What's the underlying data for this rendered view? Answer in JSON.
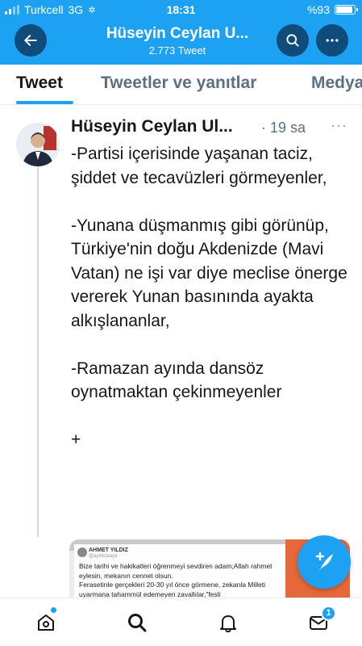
{
  "status_bar": {
    "carrier": "Turkcell",
    "network": "3G",
    "time": "18:31",
    "battery_text": "%93",
    "battery_level": 0.93
  },
  "header": {
    "title": "Hüseyin Ceylan U...",
    "subtitle": "2.773 Tweet",
    "back_icon": "arrow-left-icon",
    "search_icon": "search-icon",
    "more_icon": "more-horizontal-icon"
  },
  "tabs": [
    {
      "label": "Tweet",
      "active": true
    },
    {
      "label": "Tweetler ve yanıtlar",
      "active": false
    },
    {
      "label": "Medya",
      "active": false
    }
  ],
  "tweet": {
    "author": "Hüseyin Ceylan Ul...",
    "time": "· 19 sa",
    "more": "···",
    "text": "-Partisi içerisinde yaşanan taciz, şiddet ve tecavüzleri görmeyenler,\n\n-Yunana düşmanmış gibi görünüp, Türkiye'nin doğu Akdenizde (Mavi Vatan) ne işi var diye meclise önerge vererek Yunan basınında ayakta alkışlananlar,\n\n-Ramazan ayında dansöz oynatmaktan çekinmeyenler\n\n+",
    "media": {
      "author": "AHMET YILDIZ",
      "handle": "@ayildizkaya",
      "text": "Bize tarihi ve hakikatleri öğrenmeyi sevdiren adam;Allah rahmet eylesin, mekanın cennet olsun.\nFerasetinle gerçekleri 20-30 yıl önce görmene, zekanla Milleti uyarmana tahammül edemeyen zavallılar,\"fesli"
    }
  },
  "fab": {
    "icon": "compose-tweet-icon"
  },
  "colors": {
    "brand": "#1da1f2",
    "header_button": "#0f4c7a",
    "secondary_text": "#5b7083"
  },
  "bottom_nav": {
    "items": [
      "home-icon",
      "search-icon",
      "notifications-icon",
      "messages-icon"
    ],
    "messages_badge": "1"
  }
}
